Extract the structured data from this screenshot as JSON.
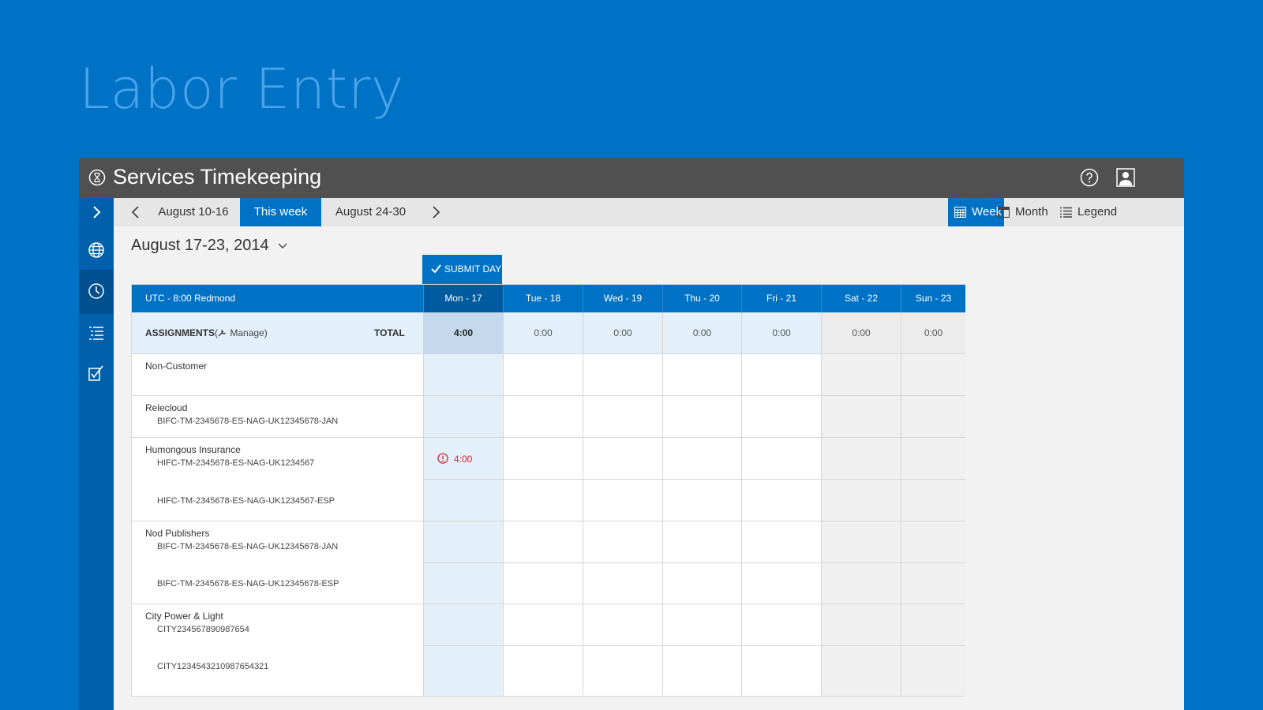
{
  "page": {
    "title": "Labor Entry"
  },
  "app": {
    "name": "Services Timekeeping"
  },
  "nav": {
    "prev_label": "August 10-16",
    "current_label": "This week",
    "next_label": "August 24-30",
    "views": [
      {
        "label": "Week",
        "active": true
      },
      {
        "label": "Month",
        "active": false
      },
      {
        "label": "Legend",
        "active": false
      }
    ]
  },
  "date_range": "August 17-23, 2014",
  "submit_label": "SUBMIT DAY",
  "grid": {
    "timezone": "UTC - 8:00 Redmond",
    "days": [
      "Mon - 17",
      "Tue - 18",
      "Wed - 19",
      "Thu - 20",
      "Fri - 21",
      "Sat - 22",
      "Sun - 23"
    ],
    "assignments_label": "ASSIGNMENTS",
    "manage_label": "Manage",
    "total_label": "TOTAL",
    "totals": [
      "4:00",
      "0:00",
      "0:00",
      "0:00",
      "0:00",
      "0:00",
      "0:00"
    ],
    "rows": [
      {
        "customer": "Non-Customer",
        "codes": []
      },
      {
        "customer": "Relecloud",
        "codes": [
          "BIFC-TM-2345678-ES-NAG-UK12345678-JAN"
        ]
      },
      {
        "customer": "Humongous Insurance",
        "codes": [
          "HIFC-TM-2345678-ES-NAG-UK1234567",
          "HIFC-TM-2345678-ES-NAG-UK1234567-ESP"
        ]
      },
      {
        "customer": "Nod Publishers",
        "codes": [
          "BIFC-TM-2345678-ES-NAG-UK12345678-JAN",
          "BIFC-TM-2345678-ES-NAG-UK12345678-ESP"
        ]
      },
      {
        "customer": "City Power & Light",
        "codes": [
          "CITY234567890987654",
          "CITY1234543210987654321"
        ]
      }
    ],
    "entry_warning_value": "4:00"
  },
  "colors": {
    "accent": "#0072c6",
    "titlebar": "#505050",
    "warning": "#d9262f"
  }
}
